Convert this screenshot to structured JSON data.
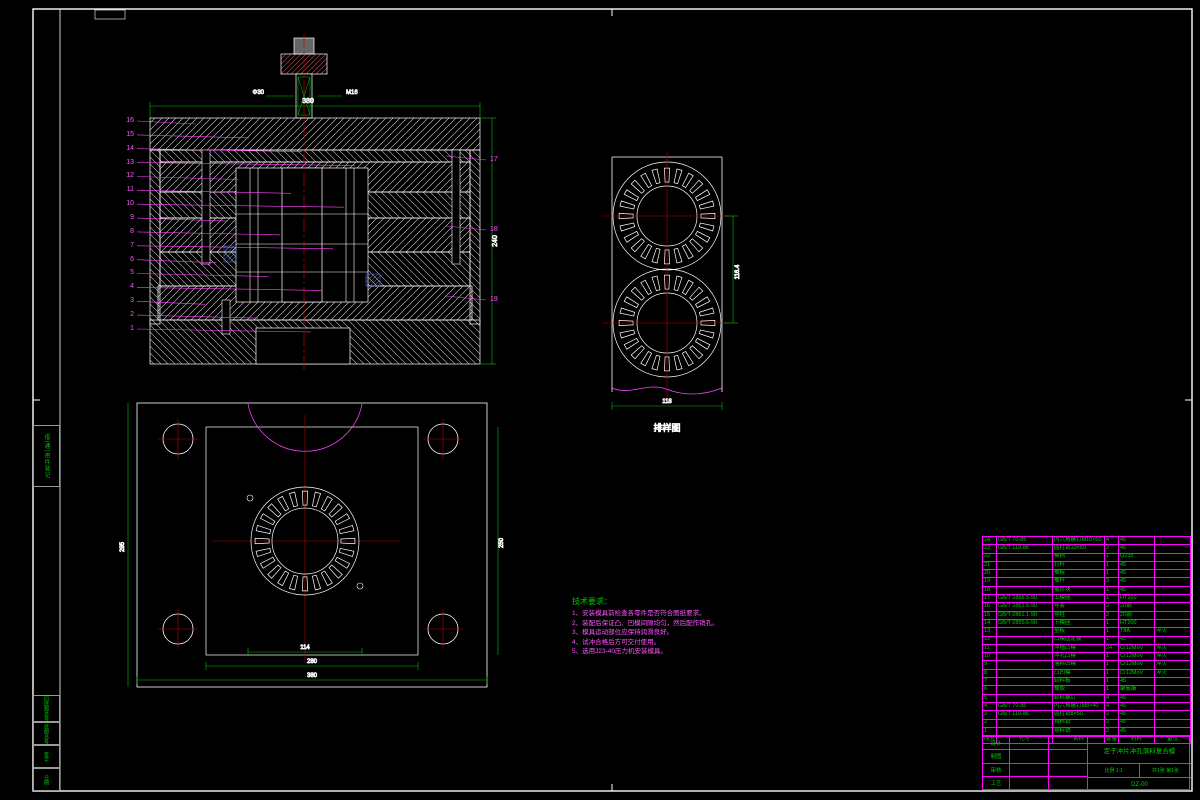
{
  "colors": {
    "bg": "#000000",
    "line": "#ffffff",
    "dim": "#00c800",
    "anno": "#ff44ff",
    "center": "#c00000",
    "blue": "#4d6dff"
  },
  "frame": {
    "left_mid": "借(通)用件登记",
    "left_bottom": [
      "旧底图总号",
      "底图总号",
      "签字",
      "日期"
    ]
  },
  "section_view": {
    "callouts_left": [
      "16",
      "15",
      "14",
      "13",
      "12",
      "11",
      "10",
      "9",
      "8",
      "7",
      "6",
      "5",
      "4",
      "3",
      "2",
      "1"
    ],
    "callouts_right": [
      "17",
      "18",
      "19"
    ]
  },
  "dims": {
    "sec_top": "380",
    "sec_right": "240",
    "sec_stem1": "M16",
    "sec_stem2": "Φ30",
    "plan_bottom1": "114",
    "plan_bottom2": "280",
    "plan_bottom3": "380",
    "plan_left": "285",
    "plan_right": "250",
    "lay_step": "116.4",
    "lay_width": "118"
  },
  "layout_view": {
    "label": "排样图"
  },
  "tech": {
    "title": "技术要求：",
    "items": [
      "1、安装模具前检查各零件是否符合图纸要求。",
      "2、装配后保证凸、凹模间隙均匀，然后配作销孔。",
      "3、模具运动部位应保持润滑良好。",
      "4、试冲合格后方可交付使用。",
      "5、选用J23-40压力机安装模具。"
    ]
  },
  "bom": {
    "headers": [
      "序号",
      "代号",
      "名称",
      "数量",
      "材料",
      "备注"
    ],
    "rows": [
      {
        "seq": "24",
        "code": "GB/T 70-85",
        "name": "内六角螺钉M10×50",
        "qty": "4",
        "mat": "45",
        "remark": ""
      },
      {
        "seq": "23",
        "code": "GB/T 119-86",
        "name": "圆柱销10×60",
        "qty": "2",
        "mat": "45",
        "remark": ""
      },
      {
        "seq": "22",
        "code": "",
        "name": "模柄",
        "qty": "1",
        "mat": "Q235",
        "remark": ""
      },
      {
        "seq": "21",
        "code": "",
        "name": "打杆",
        "qty": "1",
        "mat": "45",
        "remark": ""
      },
      {
        "seq": "20",
        "code": "",
        "name": "推板",
        "qty": "1",
        "mat": "45",
        "remark": ""
      },
      {
        "seq": "19",
        "code": "",
        "name": "推杆",
        "qty": "3",
        "mat": "45",
        "remark": ""
      },
      {
        "seq": "18",
        "code": "",
        "name": "推件块",
        "qty": "1",
        "mat": "45",
        "remark": ""
      },
      {
        "seq": "17",
        "code": "GB/T 2855.5-90",
        "name": "上模座",
        "qty": "1",
        "mat": "HT200",
        "remark": ""
      },
      {
        "seq": "16",
        "code": "GB/T 2861.6-90",
        "name": "导套",
        "qty": "2",
        "mat": "20钢",
        "remark": ""
      },
      {
        "seq": "15",
        "code": "GB/T 2861.1-90",
        "name": "导柱",
        "qty": "2",
        "mat": "20钢",
        "remark": ""
      },
      {
        "seq": "14",
        "code": "GB/T 2855.6-90",
        "name": "下模座",
        "qty": "1",
        "mat": "HT200",
        "remark": ""
      },
      {
        "seq": "13",
        "code": "",
        "name": "垫板",
        "qty": "1",
        "mat": "T8A",
        "remark": "淬火"
      },
      {
        "seq": "12",
        "code": "",
        "name": "凸模固定板",
        "qty": "1",
        "mat": "45",
        "remark": ""
      },
      {
        "seq": "11",
        "code": "",
        "name": "冲槽凸模",
        "qty": "24",
        "mat": "Cr12MoV",
        "remark": "淬火"
      },
      {
        "seq": "10",
        "code": "",
        "name": "冲孔凸模",
        "qty": "1",
        "mat": "Cr12MoV",
        "remark": "淬火"
      },
      {
        "seq": "9",
        "code": "",
        "name": "落料凹模",
        "qty": "1",
        "mat": "Cr12MoV",
        "remark": "淬火"
      },
      {
        "seq": "8",
        "code": "",
        "name": "凸凹模",
        "qty": "1",
        "mat": "Cr12MoV",
        "remark": "淬火"
      },
      {
        "seq": "7",
        "code": "",
        "name": "卸料板",
        "qty": "1",
        "mat": "45",
        "remark": ""
      },
      {
        "seq": "6",
        "code": "",
        "name": "橡胶",
        "qty": "1",
        "mat": "聚氨酯",
        "remark": ""
      },
      {
        "seq": "5",
        "code": "",
        "name": "卸料螺钉",
        "qty": "4",
        "mat": "45",
        "remark": ""
      },
      {
        "seq": "4",
        "code": "GB/T 70-85",
        "name": "内六角螺钉M8×40",
        "qty": "4",
        "mat": "45",
        "remark": ""
      },
      {
        "seq": "3",
        "code": "GB/T 119-86",
        "name": "圆柱销8×50",
        "qty": "2",
        "mat": "45",
        "remark": ""
      },
      {
        "seq": "2",
        "code": "",
        "name": "挡料销",
        "qty": "2",
        "mat": "45",
        "remark": ""
      },
      {
        "seq": "1",
        "code": "",
        "name": "导料销",
        "qty": "2",
        "mat": "45",
        "remark": ""
      }
    ]
  },
  "title_block": {
    "rows": [
      "设计",
      "制图",
      "审核",
      "工艺"
    ],
    "title": "定子冲片冲孔落料复合模",
    "scale_text": "比例 1:1",
    "sheet_text": "共1张 第1张",
    "dwg_no": "DZ-00"
  }
}
